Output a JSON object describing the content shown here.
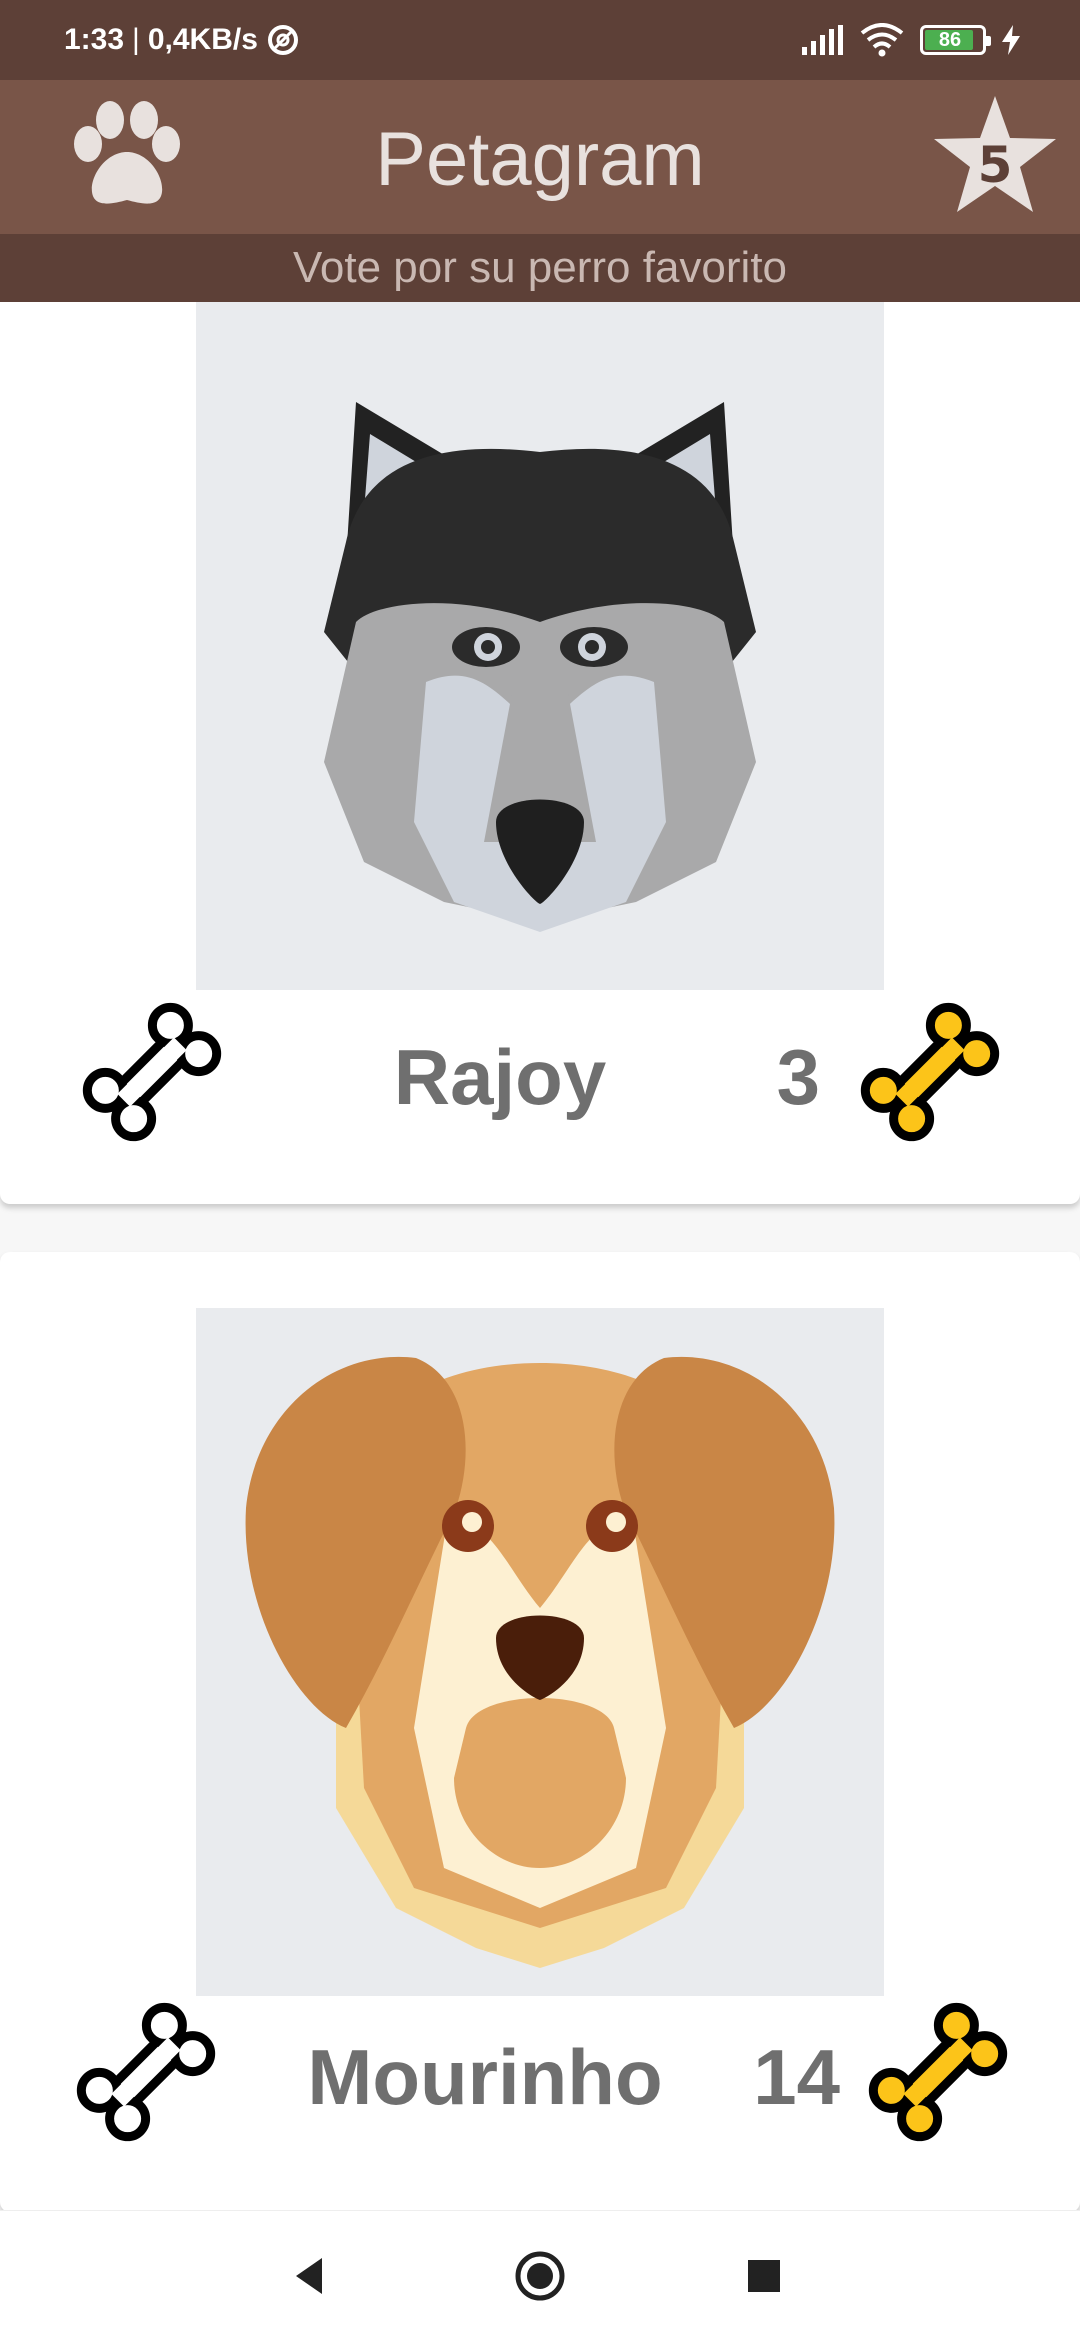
{
  "status_bar": {
    "time": "1:33",
    "speed": "0,4KB/s",
    "battery": "86"
  },
  "app_bar": {
    "title": "Petagram",
    "left_icon": "paw-icon",
    "right_icon": "star-icon",
    "favorites_count": "5"
  },
  "subtitle": "Vote por su perro favorito",
  "pets": [
    {
      "name": "Rajoy",
      "likes": "3",
      "photo": "husky-illustration"
    },
    {
      "name": "Mourinho",
      "likes": "14",
      "photo": "golden-dog-illustration"
    }
  ],
  "colors": {
    "primary": "#795548",
    "primary_dark": "#5d4037",
    "bone_outline": "#000000",
    "bone_filled": "#fcc419"
  },
  "nav_bar": {
    "icons": [
      "back-icon",
      "home-icon",
      "recents-icon"
    ]
  }
}
